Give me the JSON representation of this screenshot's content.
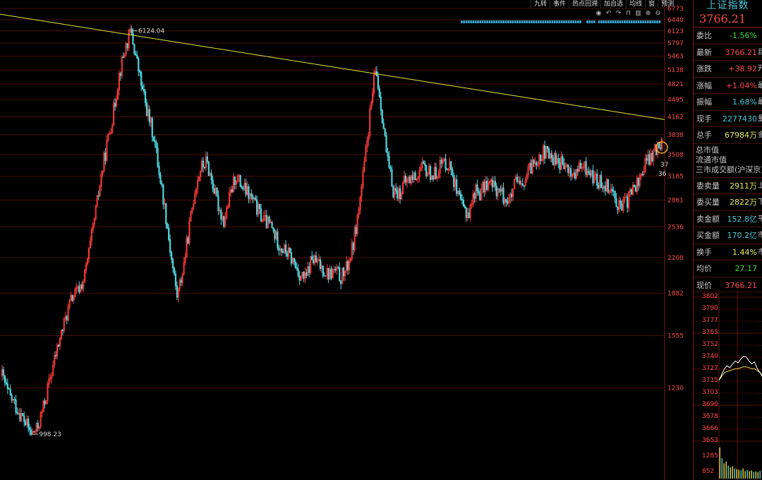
{
  "toolbar": {
    "tabs": [
      "九转",
      "事件",
      "热点回溯",
      "加自选",
      "均线",
      "窗",
      "预测"
    ],
    "icons": [
      "eye-icon",
      "undo-icon",
      "redo-icon",
      "lock-icon",
      "trash-icon",
      "zoom-in-icon",
      "zoom-out-icon"
    ]
  },
  "chart_data": {
    "type": "line",
    "series_style": "candlestick",
    "ylim": [
      852,
      6773
    ],
    "y_scale": "log",
    "yticks": [
      "6773",
      "6440",
      "6123",
      "5797",
      "5463",
      "5138",
      "4821",
      "4495",
      "4162",
      "3838",
      "3508",
      "3185",
      "2861",
      "2536",
      "2208",
      "1882",
      "1555",
      "1230"
    ],
    "annotations": [
      {
        "label": "6124.04",
        "value": 6124.04
      },
      {
        "label": "998.23",
        "value": 998.23
      }
    ],
    "overlay_labels": [
      "37",
      "36"
    ],
    "trendline": {
      "start": 6600,
      "end": 4110,
      "color": "#e8e83a"
    },
    "price_path": [
      1300,
      1200,
      1150,
      1100,
      1050,
      998.23,
      1020,
      1120,
      1250,
      1400,
      1550,
      1700,
      1850,
      1900,
      2000,
      2300,
      2700,
      3200,
      3700,
      4200,
      5000,
      5600,
      6124.04,
      5400,
      4700,
      4200,
      3800,
      3200,
      2700,
      2200,
      1850,
      2100,
      2500,
      3000,
      3300,
      3400,
      3100,
      2800,
      2600,
      2900,
      3200,
      3050,
      2950,
      2850,
      2700,
      2600,
      2550,
      2400,
      2300,
      2250,
      2150,
      2050,
      2000,
      2200,
      2150,
      2100,
      2050,
      2080,
      2020,
      2100,
      2300,
      2700,
      3300,
      4200,
      5178,
      4300,
      3400,
      3000,
      2950,
      3100,
      3150,
      3200,
      3300,
      3250,
      3200,
      3350,
      3400,
      3300,
      2900,
      2750,
      2700,
      3000,
      2950,
      3100,
      3050,
      3000,
      2900,
      2850,
      3100,
      3000,
      3200,
      3400,
      3500,
      3550,
      3450,
      3450,
      3350,
      3250,
      3200,
      3300,
      3300,
      3200,
      3100,
      3100,
      3050,
      2900,
      2750,
      2850,
      3000,
      3100,
      3350,
      3450,
      3600,
      3766.21
    ]
  },
  "quote": {
    "name": "上证指数",
    "price": "3766.21",
    "rows": [
      {
        "label": "委比",
        "value": "-1.56%",
        "tone": "green",
        "cut": ""
      },
      {
        "label": "最新",
        "value": "3766.21",
        "tone": "red",
        "cut": "目"
      },
      {
        "label": "涨跌",
        "value": "+38.92",
        "tone": "red",
        "cut": "开"
      },
      {
        "label": "涨幅",
        "value": "+1.04%",
        "tone": "red",
        "cut": "最"
      },
      {
        "label": "振幅",
        "value": "1.68%",
        "tone": "cyan",
        "cut": "最"
      },
      {
        "label": "现手",
        "value": "2277430",
        "tone": "cyan",
        "cut": "量"
      },
      {
        "label": "总手",
        "value": "67984万",
        "tone": "yellow",
        "cut": "金"
      }
    ],
    "plain_rows": [
      "总市值",
      "流通市值",
      "三市成交额(沪深京)"
    ],
    "rows2": [
      {
        "label": "委卖量",
        "value": "2911万",
        "tone": "yellow",
        "cut": "上"
      },
      {
        "label": "委买量",
        "value": "2822万",
        "tone": "yellow",
        "cut": "下"
      },
      {
        "label": "卖金额",
        "value": "152.8亿",
        "tone": "cyan",
        "cut": "平"
      },
      {
        "label": "买金额",
        "value": "170.2亿",
        "tone": "cyan",
        "cut": "市"
      },
      {
        "label": "换手",
        "value": "1.44%",
        "tone": "yellow",
        "cut": "市"
      },
      {
        "label": "均价",
        "value": "27.17",
        "tone": "green",
        "cut": ""
      }
    ],
    "current_label": "现价",
    "current_value": "3766.21"
  },
  "mini_chart": {
    "yticks": [
      "3802",
      "3790",
      "3777",
      "3765",
      "3752",
      "3740",
      "3727",
      "3715",
      "3703",
      "3690",
      "3678",
      "3666",
      "3653",
      "1285",
      "852"
    ],
    "price": [
      3716,
      3722,
      3728,
      3731,
      3729,
      3733,
      3736,
      3734,
      3738,
      3741,
      3740,
      3736,
      3733,
      3735,
      3728,
      3724,
      3719
    ],
    "avg": [
      3716,
      3720,
      3724,
      3725,
      3726,
      3727,
      3728,
      3728,
      3729,
      3730,
      3730,
      3729,
      3728,
      3728,
      3726,
      3724,
      3721
    ],
    "ylim": [
      3653,
      3802
    ],
    "volume": [
      0.92,
      0.6,
      0.45,
      0.5,
      0.38,
      0.33,
      0.36,
      0.3,
      0.28,
      0.26,
      0.24,
      0.3,
      0.22,
      0.25,
      0.22,
      0.24,
      0.2,
      0.21,
      0.19,
      0.23
    ]
  }
}
